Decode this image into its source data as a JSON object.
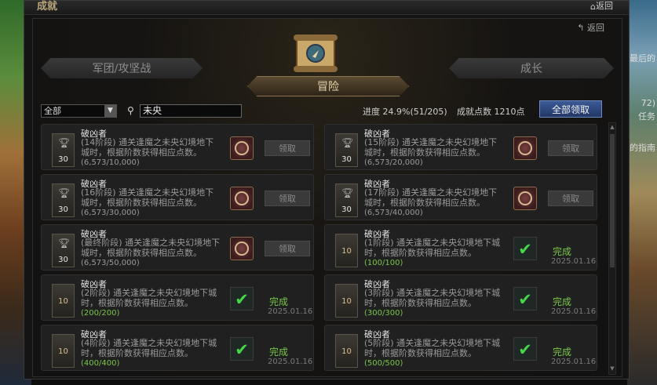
{
  "window": {
    "title": "成就",
    "back_top": "返回"
  },
  "panel": {
    "back": "返回"
  },
  "tabs": {
    "left": "军团/攻坚战",
    "middle": "冒险",
    "right": "成长"
  },
  "filter": {
    "selected": "全部",
    "search_value": "未央"
  },
  "progress": {
    "text": "进度 24.9%(51/205)",
    "points": "成就点数 1210点"
  },
  "claim_all": "全部领取",
  "background_right": {
    "line1": "最后的",
    "line2": "72)",
    "line3": "任务",
    "line4": "的指南"
  },
  "cards": [
    {
      "name": "破凶者",
      "desc": "(14阶段) 通关逢魔之未央幻境地下城时，根据阶数获得相应点数。",
      "count": "(6,573/10,000)",
      "points": "30",
      "state": "claim",
      "action": "领取"
    },
    {
      "name": "破凶者",
      "desc": "(15阶段) 通关逢魔之未央幻境地下城时，根据阶数获得相应点数。",
      "count": "(6,573/20,000)",
      "points": "30",
      "state": "claim",
      "action": "领取"
    },
    {
      "name": "破凶者",
      "desc": "(16阶段) 通关逢魔之未央幻境地下城时，根据阶数获得相应点数。",
      "count": "(6,573/30,000)",
      "points": "30",
      "state": "claim",
      "action": "领取"
    },
    {
      "name": "破凶者",
      "desc": "(17阶段) 通关逢魔之未央幻境地下城时，根据阶数获得相应点数。",
      "count": "(6,573/40,000)",
      "points": "30",
      "state": "claim",
      "action": "领取"
    },
    {
      "name": "破凶者",
      "desc": "(最终阶段) 通关逢魔之未央幻境地下城时，根据阶数获得相应点数。",
      "count": "(6,573/50,000)",
      "points": "30",
      "state": "claim",
      "action": "领取"
    },
    {
      "name": "破凶者",
      "desc": "(1阶段) 通关逢魔之未央幻境地下城时，根据阶数获得相应点数。",
      "count": "(100/100)",
      "points": "10",
      "state": "done",
      "action": "完成",
      "date": "2025.01.16"
    },
    {
      "name": "破凶者",
      "desc": "(2阶段) 通关逢魔之未央幻境地下城时，根据阶数获得相应点数。",
      "count": "(200/200)",
      "points": "10",
      "state": "done",
      "action": "完成",
      "date": "2025.01.16"
    },
    {
      "name": "破凶者",
      "desc": "(3阶段) 通关逢魔之未央幻境地下城时，根据阶数获得相应点数。",
      "count": "(300/300)",
      "points": "10",
      "state": "done",
      "action": "完成",
      "date": "2025.01.16"
    },
    {
      "name": "破凶者",
      "desc": "(4阶段) 通关逢魔之未央幻境地下城时，根据阶数获得相应点数。",
      "count": "(400/400)",
      "points": "10",
      "state": "done",
      "action": "完成",
      "date": "2025.01.16"
    },
    {
      "name": "破凶者",
      "desc": "(5阶段) 通关逢魔之未央幻境地下城时，根据阶数获得相应点数。",
      "count": "(500/500)",
      "points": "10",
      "state": "done",
      "action": "完成",
      "date": "2025.01.16"
    }
  ]
}
